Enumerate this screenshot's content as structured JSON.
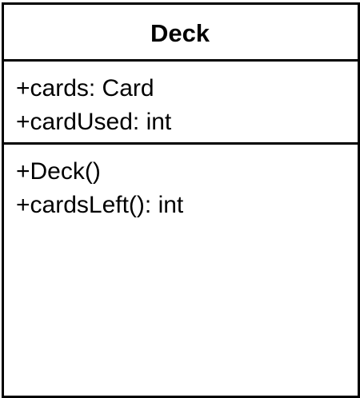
{
  "uml_class": {
    "name": "Deck",
    "attributes": [
      "+cards: Card",
      "+cardUsed: int"
    ],
    "operations": [
      "+Deck()",
      "+cardsLeft(): int"
    ]
  }
}
